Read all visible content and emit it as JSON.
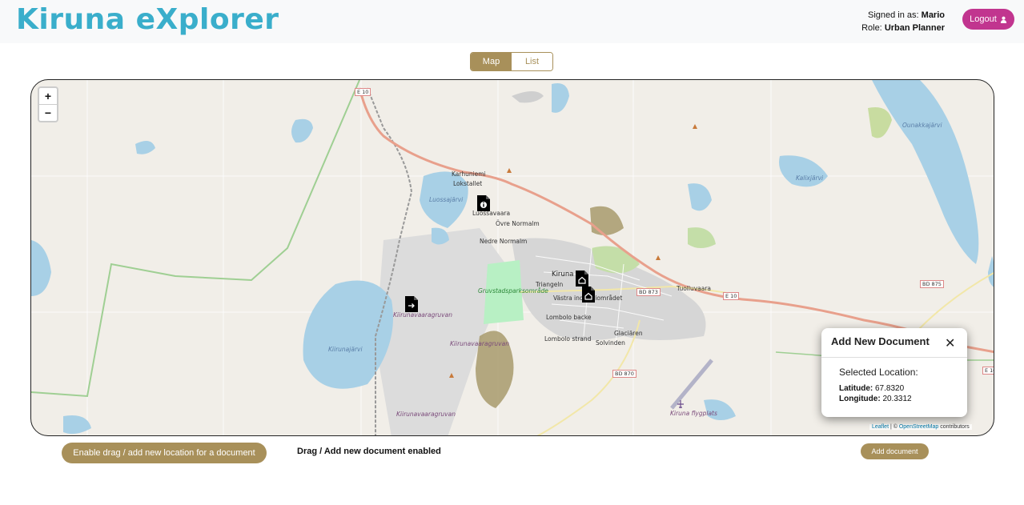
{
  "header": {
    "brand": "Kiruna eXplorer",
    "signed_in_label": "Signed in as:",
    "user_name": "Mario",
    "role_label": "Role:",
    "role_value": "Urban Planner",
    "logout_label": "Logout"
  },
  "view_toggle": {
    "map_label": "Map",
    "list_label": "List",
    "selected": "Map"
  },
  "map": {
    "zoom_in": "+",
    "zoom_out": "−",
    "labels": {
      "e10_a": "E 10",
      "e10_b": "E 10",
      "e10_c": "E 10",
      "bd873": "BD 873",
      "bd875": "BD 875",
      "bd870": "BD 870",
      "karhuniemi": "Karhuniemi",
      "lokstallet": "Lokstallet",
      "luossavaara": "Luossavaara",
      "ovre_normalm": "Övre Normalm",
      "nedre_normalm": "Nedre Normalm",
      "kiruna": "Kiruna",
      "triangeln": "Triangeln",
      "vastra": "Västra industriområdet",
      "lombolo_backe": "Lombolo backe",
      "lombolo_strand": "Lombolo strand",
      "solvinden": "Solvinden",
      "glaciaren": "Glaciären",
      "tuolluvaara": "Tuolluvaara",
      "kiirunavaara1": "Kiirunavaaragruvan",
      "kiirunavaara2": "Kiirunavaaragruvan",
      "kiirunavaara3": "Kiirunavaaragruvan",
      "gruvstad": "Gruvstadsparksområde",
      "luossajarvi": "Luossajärvi",
      "kiirunajarvi": "Kiirunajärvi",
      "ounakkajarvi": "Ounakkajärvi",
      "kalixjarvi": "Kalixjärvi",
      "airport": "Kiruna flygplats"
    },
    "attribution": {
      "leaflet": "Leaflet",
      "sep": " | © ",
      "osm": "OpenStreetMap",
      "suffix": " contributors"
    }
  },
  "popup": {
    "title": "Add New Document",
    "selected_label": "Selected Location:",
    "lat_label": "Latitude:",
    "lat_value": "67.8320",
    "lon_label": "Longitude:",
    "lon_value": "20.3312"
  },
  "footer": {
    "enable_button": "Enable drag / add new location for a document",
    "status": "Drag / Add new document enabled",
    "add_button": "Add document"
  },
  "colors": {
    "brand": "#3aaecb",
    "accent": "#a8905a",
    "logout": "#c1358f"
  }
}
